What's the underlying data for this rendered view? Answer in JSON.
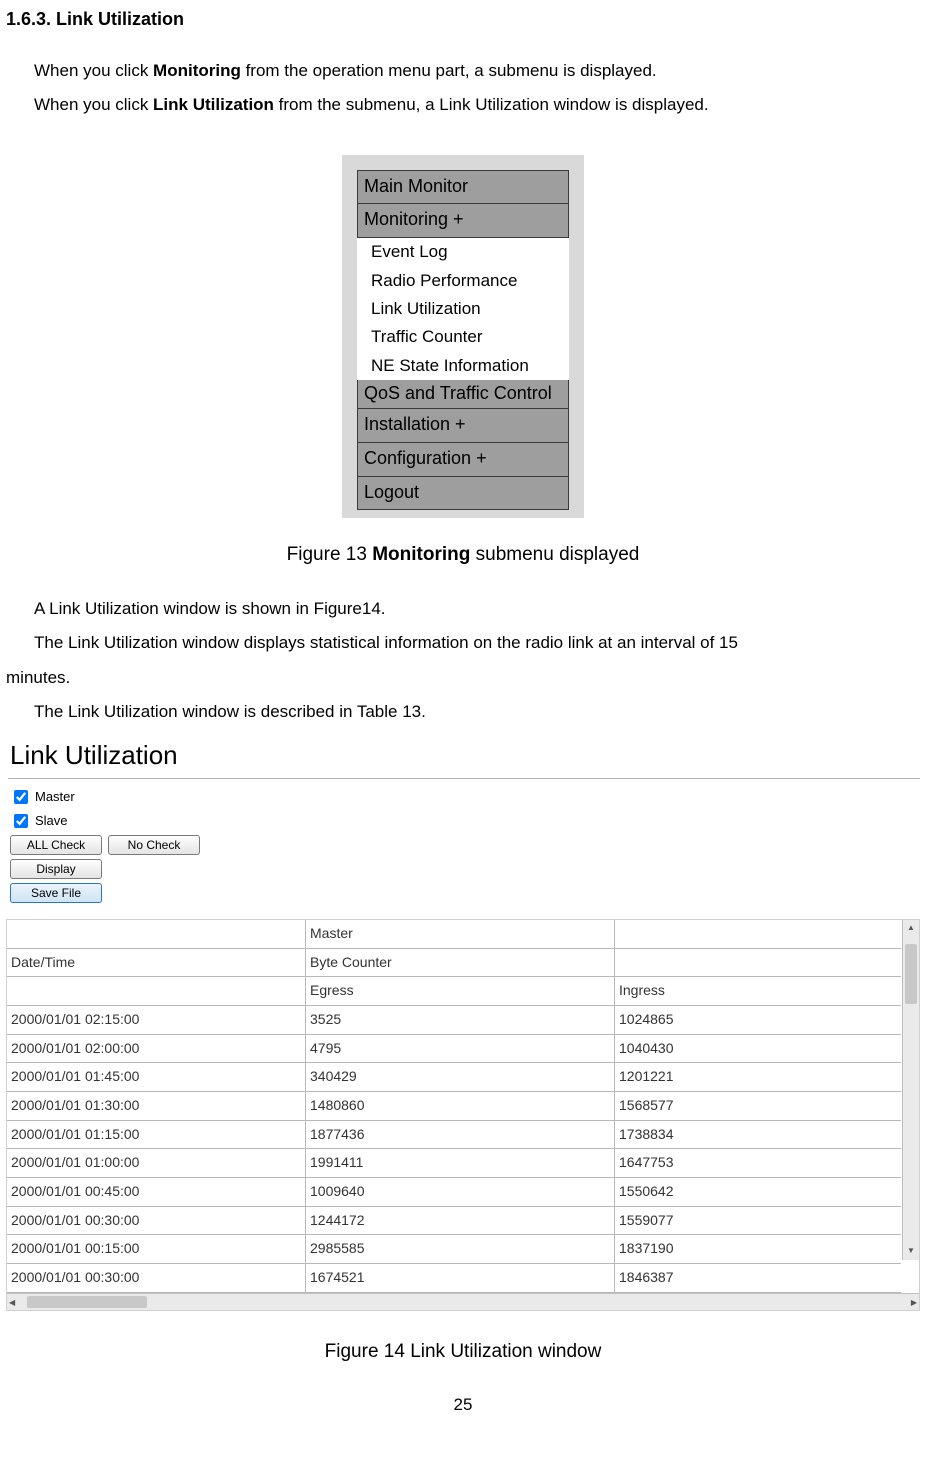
{
  "heading": "1.6.3. Link Utilization",
  "intro": {
    "p1a": "When you click ",
    "p1b": "Monitoring",
    "p1c": " from the operation menu part, a submenu is displayed.",
    "p2a": "When you click ",
    "p2b": "Link Utilization",
    "p2c": " from the submenu, a Link Utilization window is displayed."
  },
  "menu": {
    "items": {
      "main_monitor": "Main Monitor",
      "monitoring": "Monitoring +",
      "qos": "QoS and Traffic Control",
      "installation": "Installation +",
      "configuration": "Configuration +",
      "logout": "Logout"
    },
    "sub": {
      "event_log": "Event Log",
      "radio_perf": "Radio Performance",
      "link_util": "Link Utilization",
      "traffic_counter": "Traffic Counter",
      "ne_state": "NE State Information"
    }
  },
  "fig13": {
    "pre": "Figure 13 ",
    "bold": "Monitoring",
    "post": " submenu displayed"
  },
  "mid": {
    "p1": "A Link Utilization window is shown in Figure14.",
    "p2": "The Link Utilization window displays statistical information on the radio link at an interval of 15",
    "p2b": "minutes.",
    "p3": "The Link Utilization window is described in Table 13."
  },
  "lu": {
    "title": "Link Utilization",
    "master": "Master",
    "slave": "Slave",
    "all_check": "ALL Check",
    "no_check": "No Check",
    "display": "Display",
    "save_file": "Save File",
    "hdr": {
      "master": "Master",
      "datetime": "Date/Time",
      "bytecounter": "Byte Counter",
      "egress": "Egress",
      "ingress": "Ingress"
    },
    "rows": [
      {
        "dt": "2000/01/01 02:15:00",
        "eg": "3525",
        "in": "1024865"
      },
      {
        "dt": "2000/01/01 02:00:00",
        "eg": "4795",
        "in": "1040430"
      },
      {
        "dt": "2000/01/01 01:45:00",
        "eg": "340429",
        "in": "1201221"
      },
      {
        "dt": "2000/01/01 01:30:00",
        "eg": "1480860",
        "in": "1568577"
      },
      {
        "dt": "2000/01/01 01:15:00",
        "eg": "1877436",
        "in": "1738834"
      },
      {
        "dt": "2000/01/01 01:00:00",
        "eg": "1991411",
        "in": "1647753"
      },
      {
        "dt": "2000/01/01 00:45:00",
        "eg": "1009640",
        "in": "1550642"
      },
      {
        "dt": "2000/01/01 00:30:00",
        "eg": "1244172",
        "in": "1559077"
      },
      {
        "dt": "2000/01/01 00:15:00",
        "eg": "2985585",
        "in": "1837190"
      },
      {
        "dt": "2000/01/01 00:30:00",
        "eg": "1674521",
        "in": "1846387"
      }
    ]
  },
  "fig14": "Figure 14 Link Utilization window",
  "page_no": "25"
}
